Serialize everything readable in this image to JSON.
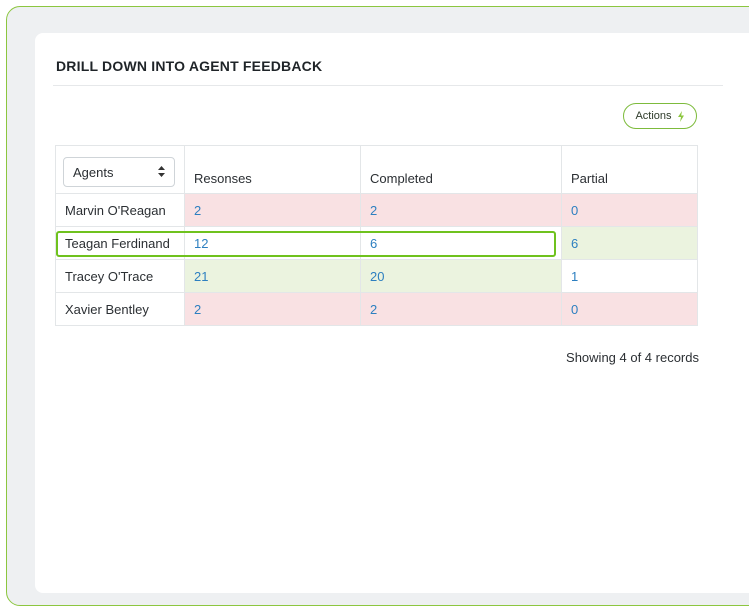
{
  "panel": {
    "title": "DRILL DOWN INTO AGENT FEEDBACK",
    "actions_label": "Actions",
    "actions_icon": "bolt-icon"
  },
  "table": {
    "agent_select": {
      "selected": "Agents",
      "icon": "updown-arrows-icon"
    },
    "columns": [
      "Resonses",
      "Completed",
      "Partial"
    ],
    "rows": [
      {
        "agent": "Marvin O'Reagan",
        "responses": "2",
        "completed": "2",
        "partial": "0",
        "status": [
          "bad",
          "bad",
          "bad"
        ]
      },
      {
        "agent": "Teagan Ferdinand",
        "responses": "12",
        "completed": "6",
        "partial": "6",
        "status": [
          "neutral",
          "neutral",
          "good"
        ],
        "highlighted": true
      },
      {
        "agent": "Tracey O'Trace",
        "responses": "21",
        "completed": "20",
        "partial": "1",
        "status": [
          "good",
          "good",
          "neutral"
        ]
      },
      {
        "agent": "Xavier Bentley",
        "responses": "2",
        "completed": "2",
        "partial": "0",
        "status": [
          "bad",
          "bad",
          "bad"
        ]
      }
    ]
  },
  "footer": {
    "records_text": "Showing 4 of 4 records"
  },
  "colors": {
    "accent": "#8cc63f",
    "highlight": "#6fc21e",
    "bad_row": "#f9e1e3",
    "good_row": "#ebf3df",
    "link_number": "#2d7fc0"
  }
}
